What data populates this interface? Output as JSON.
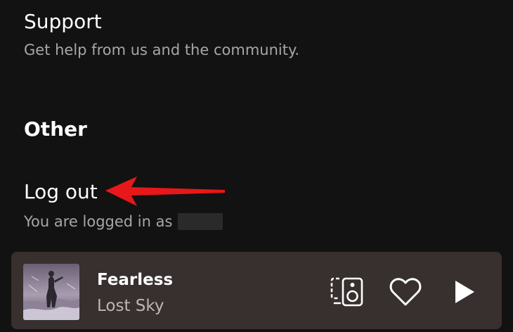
{
  "settings": {
    "support": {
      "title": "Support",
      "subtitle": "Get help from us and the community."
    },
    "other_heading": "Other",
    "logout": {
      "title": "Log out",
      "subtitle": "You are logged in as"
    }
  },
  "now_playing": {
    "title": "Fearless",
    "artist": "Lost Sky",
    "icons": [
      "album-art",
      "devices-icon",
      "heart-icon",
      "play-icon"
    ]
  },
  "colors": {
    "background": "#121212",
    "player_bar": "#37302f",
    "annotation_arrow": "#e8171a",
    "secondary_text": "#a7a7a7"
  }
}
